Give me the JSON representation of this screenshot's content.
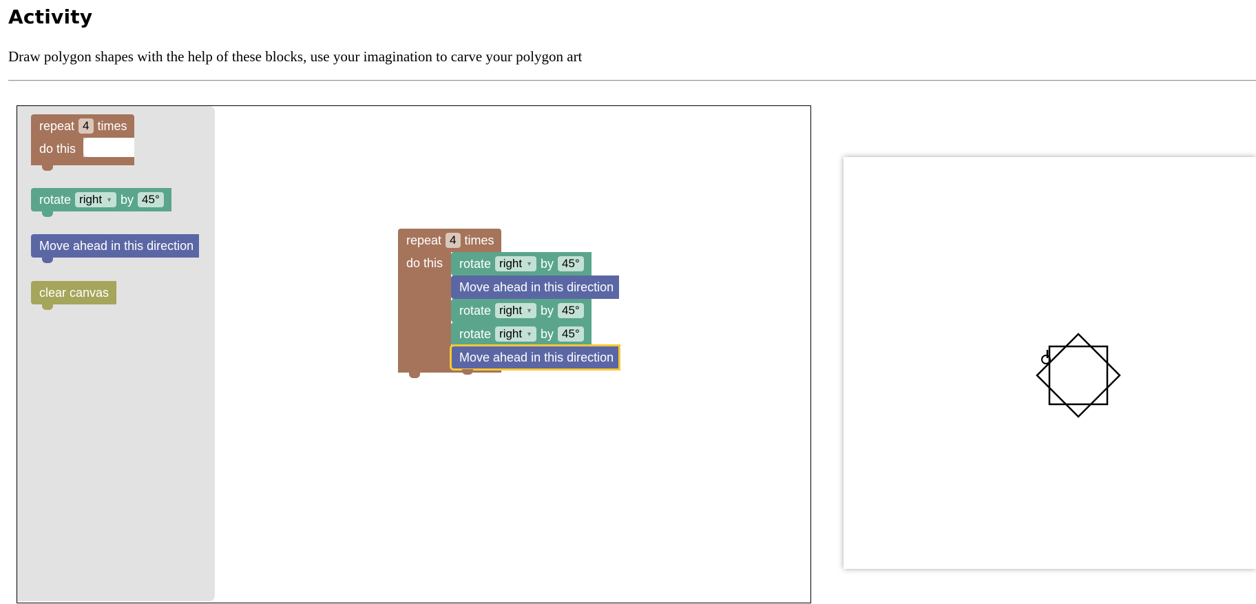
{
  "page": {
    "heading": "Activity",
    "description": "Draw polygon shapes with the help of these blocks, use your imagination to carve your polygon art"
  },
  "toolbox": {
    "repeat_block": {
      "word_repeat": "repeat",
      "count": "4",
      "word_times": "times",
      "word_do": "do this"
    },
    "rotate_block": {
      "word_rotate": "rotate",
      "direction": "right",
      "word_by": "by",
      "angle": "45°"
    },
    "move_block": {
      "label": "Move ahead in this direction"
    },
    "clear_block": {
      "label": "clear canvas"
    }
  },
  "program": {
    "repeat": {
      "word_repeat": "repeat",
      "count": "4",
      "word_times": "times",
      "word_do": "do this"
    },
    "steps": [
      {
        "word_rotate": "rotate",
        "direction": "right",
        "word_by": "by",
        "angle": "45°"
      },
      {
        "label": "Move ahead in this direction"
      },
      {
        "word_rotate": "rotate",
        "direction": "right",
        "word_by": "by",
        "angle": "45°"
      },
      {
        "word_rotate": "rotate",
        "direction": "right",
        "word_by": "by",
        "angle": "45°"
      },
      {
        "label": "Move ahead in this direction"
      }
    ]
  },
  "colors": {
    "loop_block": "#a5745b",
    "turn_block": "#5ba58c",
    "move_block": "#5b67a5",
    "clear_block": "#a5a55b",
    "selection": "#f7c831",
    "drawing": "#000000"
  },
  "icons": {
    "turtle_cursor": "pen-icon"
  }
}
